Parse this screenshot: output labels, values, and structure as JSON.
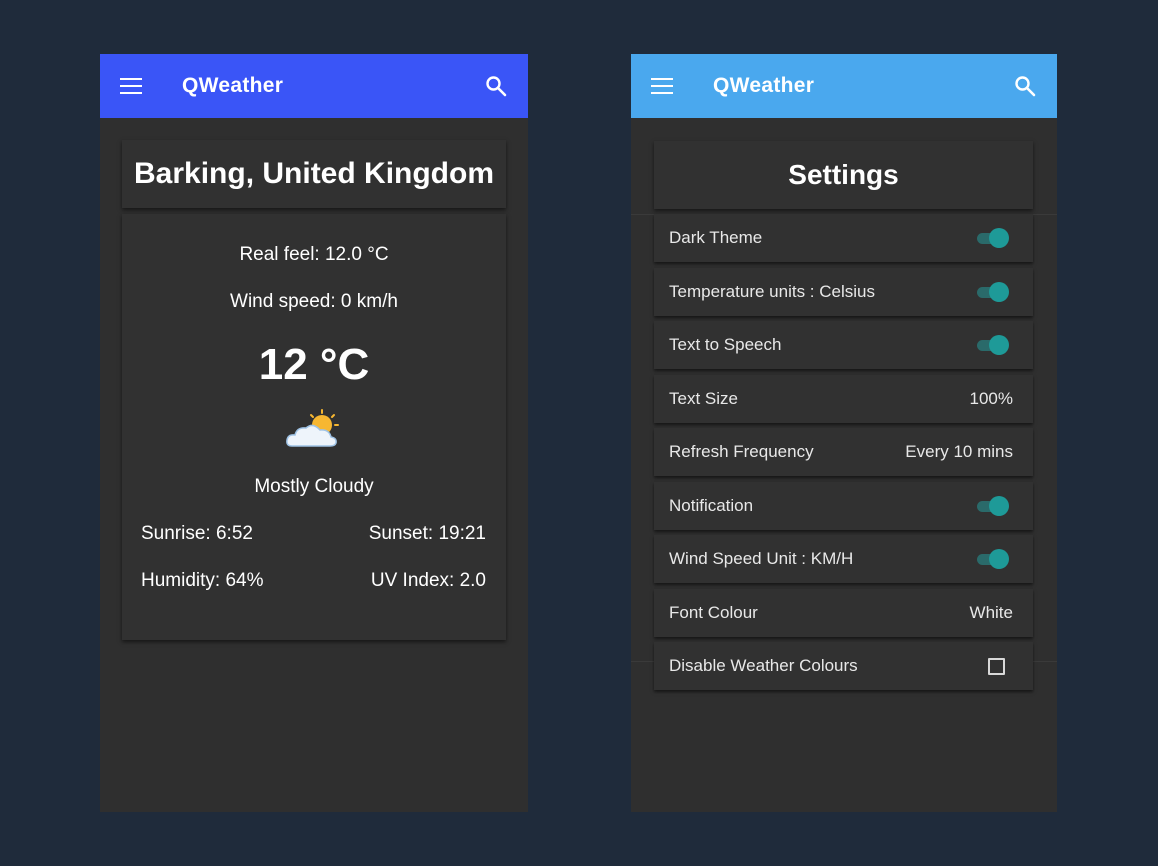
{
  "left_screen": {
    "app_title": "QWeather",
    "city": "Barking, United Kingdom",
    "real_feel": "Real feel: 12.0 °C",
    "wind_speed": "Wind speed: 0 km/h",
    "temperature": "12 °C",
    "weather_icon": "partly-cloudy-icon",
    "condition": "Mostly Cloudy",
    "sunrise": "Sunrise: 6:52",
    "sunset": "Sunset: 19:21",
    "humidity": "Humidity: 64%",
    "uv_index": "UV Index: 2.0"
  },
  "right_screen": {
    "app_title": "QWeather",
    "heading": "Settings",
    "settings": [
      {
        "label": "Dark Theme",
        "control": "toggle",
        "checked": true
      },
      {
        "label": "Temperature units : Celsius",
        "control": "toggle",
        "checked": true
      },
      {
        "label": "Text to Speech",
        "control": "toggle",
        "checked": true
      },
      {
        "label": "Text Size",
        "control": "value",
        "value": "100%"
      },
      {
        "label": "Refresh Frequency",
        "control": "value",
        "value": "Every 10 mins"
      },
      {
        "label": "Notification",
        "control": "toggle",
        "checked": true
      },
      {
        "label": "Wind Speed Unit : KM/H",
        "control": "toggle",
        "checked": true
      },
      {
        "label": "Font Colour",
        "control": "value",
        "value": "White"
      },
      {
        "label": "Disable Weather Colours",
        "control": "checkbox",
        "checked": false
      }
    ]
  },
  "colors": {
    "background": "#1f2b3b",
    "left_appbar": "#3a55f7",
    "right_appbar": "#4aa8ee",
    "toggle_on": "#1e9a98"
  }
}
